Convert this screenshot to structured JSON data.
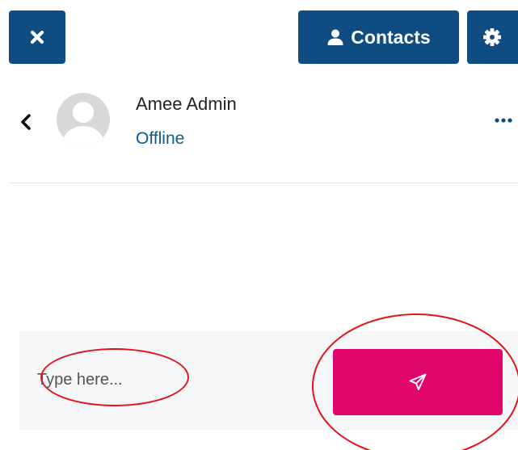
{
  "toolbar": {
    "close_icon": "times-icon",
    "contacts_label": "Contacts",
    "contacts_icon": "user-icon",
    "settings_icon": "gear-icon"
  },
  "conversation": {
    "back_icon": "chevron-left-icon",
    "avatar_icon": "default-user-avatar",
    "contact_name": "Amee Admin",
    "contact_status": "Offline",
    "more_icon": "ellipsis-horizontal-icon"
  },
  "composer": {
    "placeholder": "Type here...",
    "value": "",
    "send_icon": "paper-plane-icon"
  },
  "colors": {
    "toolbar_button_bg": "#0f4c81",
    "send_button_bg": "#e0066c",
    "status_text": "#0f5a8c",
    "composer_bg": "#f5f6f7",
    "annotation": "#e0141c"
  }
}
